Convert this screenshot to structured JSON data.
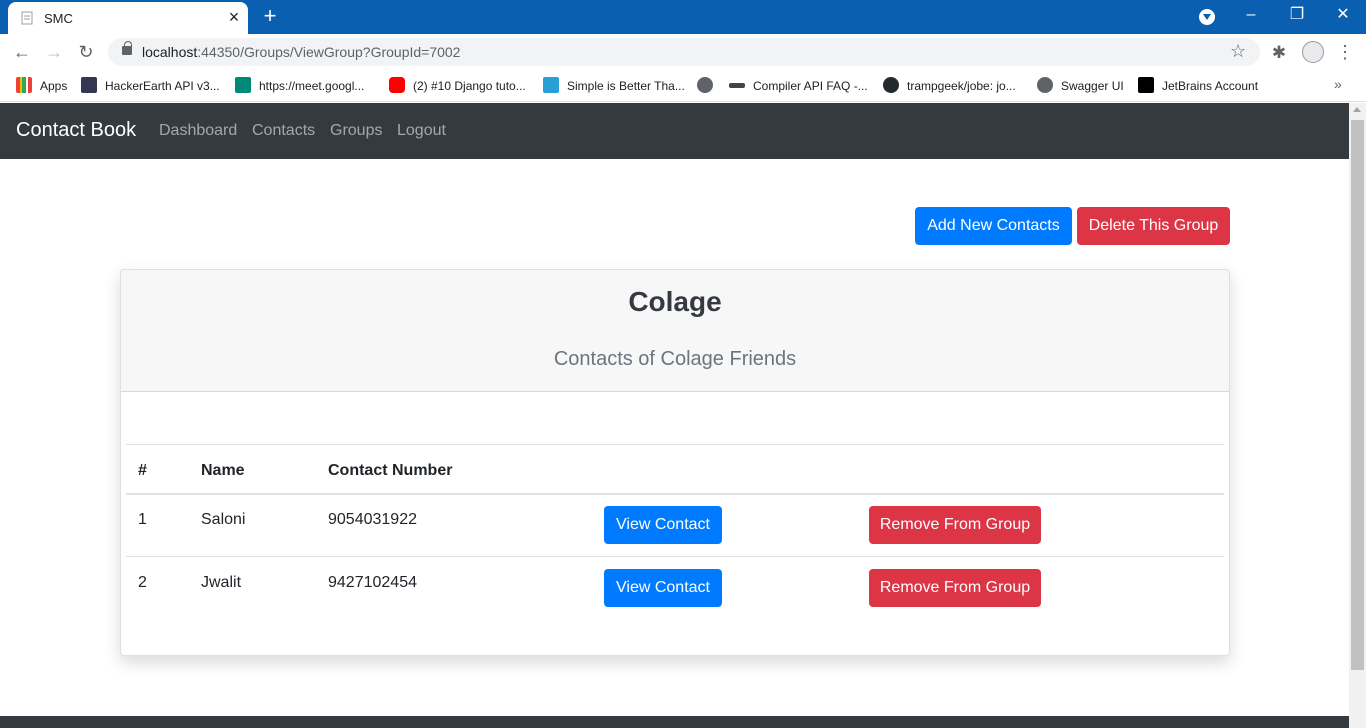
{
  "browser": {
    "tab_title": "SMC",
    "new_tab_label": "+",
    "url_host": "localhost",
    "url_rest": ":44350/Groups/ViewGroup?GroupId=7002",
    "bookmarks": [
      {
        "label": "Apps",
        "color": "#ea4335"
      },
      {
        "label": "HackerEarth API v3...",
        "color": "#323754"
      },
      {
        "label": "https://meet.googl...",
        "color": "#00897b"
      },
      {
        "label": "(2) #10 Django tuto...",
        "color": "#ff0000"
      },
      {
        "label": "Simple is Better Tha...",
        "color": "#2a9fd6"
      },
      {
        "label": "",
        "color": "#5f6368"
      },
      {
        "label": "Compiler API FAQ -...",
        "color": "#444444"
      },
      {
        "label": "trampgeek/jobe: jo...",
        "color": "#24292e"
      },
      {
        "label": "Swagger UI",
        "color": "#5f6368"
      },
      {
        "label": "JetBrains Account",
        "color": "#000000"
      }
    ]
  },
  "navbar": {
    "brand": "Contact Book",
    "links": [
      "Dashboard",
      "Contacts",
      "Groups",
      "Logout"
    ]
  },
  "actions": {
    "add": "Add New Contacts",
    "delete": "Delete This Group"
  },
  "group": {
    "name": "Colage",
    "description": "Contacts of Colage Friends"
  },
  "table": {
    "headers": [
      "#",
      "Name",
      "Contact Number"
    ],
    "rows": [
      {
        "num": "1",
        "name": "Saloni",
        "phone": "9054031922",
        "view": "View Contact",
        "remove": "Remove From Group"
      },
      {
        "num": "2",
        "name": "Jwalit",
        "phone": "9427102454",
        "view": "View Contact",
        "remove": "Remove From Group"
      }
    ]
  },
  "colors": {
    "primary": "#007bff",
    "danger": "#dc3545",
    "navbar": "#343a40",
    "chrome": "#0b5fb0"
  }
}
